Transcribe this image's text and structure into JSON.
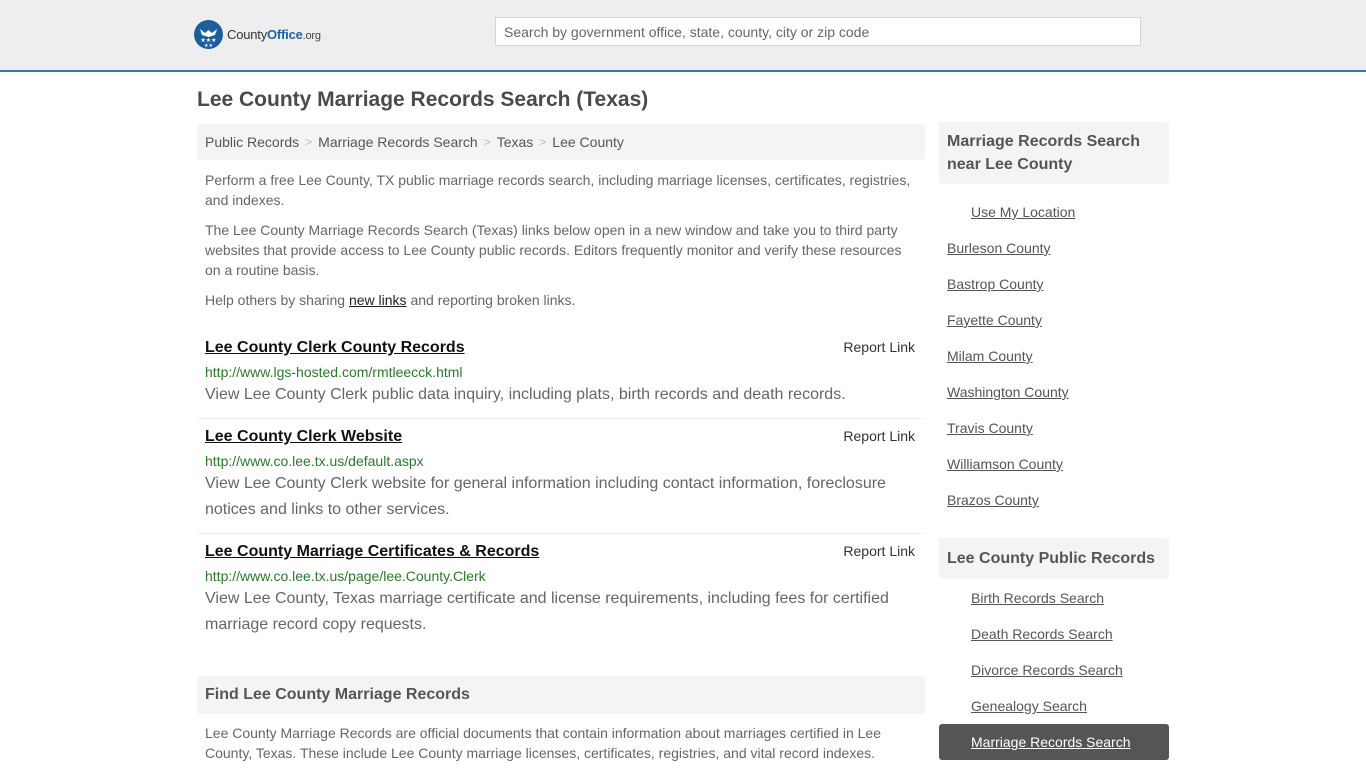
{
  "header": {
    "logo": {
      "brand_prefix": "County",
      "brand_main": "Office",
      "brand_suffix": ".org",
      "icon": "eagle-stars-icon"
    },
    "search": {
      "placeholder": "Search by government office, state, county, city or zip code",
      "value": ""
    },
    "accent_color": "#2f7bb9"
  },
  "page_title": "Lee County Marriage Records Search (Texas)",
  "breadcrumb": [
    {
      "label": "Public Records"
    },
    {
      "label": "Marriage Records Search"
    },
    {
      "label": "Texas"
    },
    {
      "label": "Lee County"
    }
  ],
  "breadcrumb_separator": ">",
  "intro": {
    "p1": "Perform a free Lee County, TX public marriage records search, including marriage licenses, certificates, registries, and indexes.",
    "p2": "The Lee County Marriage Records Search (Texas) links below open in a new window and take you to third party websites that provide access to Lee County public records. Editors frequently monitor and verify these resources on a routine basis.",
    "p3_before": "Help others by sharing ",
    "p3_link": "new links",
    "p3_after": " and reporting broken links."
  },
  "results": [
    {
      "title": "Lee County Clerk County Records",
      "report_label": "Report Link",
      "url": "http://www.lgs-hosted.com/rmtleecck.html",
      "description": "View Lee County Clerk public data inquiry, including plats, birth records and death records."
    },
    {
      "title": "Lee County Clerk Website",
      "report_label": "Report Link",
      "url": "http://www.co.lee.tx.us/default.aspx",
      "description": "View Lee County Clerk website for general information including contact information, foreclosure notices and links to other services."
    },
    {
      "title": "Lee County Marriage Certificates & Records",
      "report_label": "Report Link",
      "url": "http://www.co.lee.tx.us/page/lee.County.Clerk",
      "description": "View Lee County, Texas marriage certificate and license requirements, including fees for certified marriage record copy requests."
    }
  ],
  "find_section": {
    "heading": "Find Lee County Marriage Records",
    "text": "Lee County Marriage Records are official documents that contain information about marriages certified in Lee County, Texas. These include Lee County marriage licenses, certificates, registries, and vital record indexes."
  },
  "sidebar": {
    "near": {
      "heading": "Marriage Records Search near Lee County",
      "use_location": "Use My Location",
      "counties": [
        "Burleson County",
        "Bastrop County",
        "Fayette County",
        "Milam County",
        "Washington County",
        "Travis County",
        "Williamson County",
        "Brazos County"
      ]
    },
    "public_records": {
      "heading": "Lee County Public Records",
      "items": [
        {
          "label": "Birth Records Search",
          "active": false
        },
        {
          "label": "Death Records Search",
          "active": false
        },
        {
          "label": "Divorce Records Search",
          "active": false
        },
        {
          "label": "Genealogy Search",
          "active": false
        },
        {
          "label": "Marriage Records Search",
          "active": true
        }
      ]
    }
  }
}
